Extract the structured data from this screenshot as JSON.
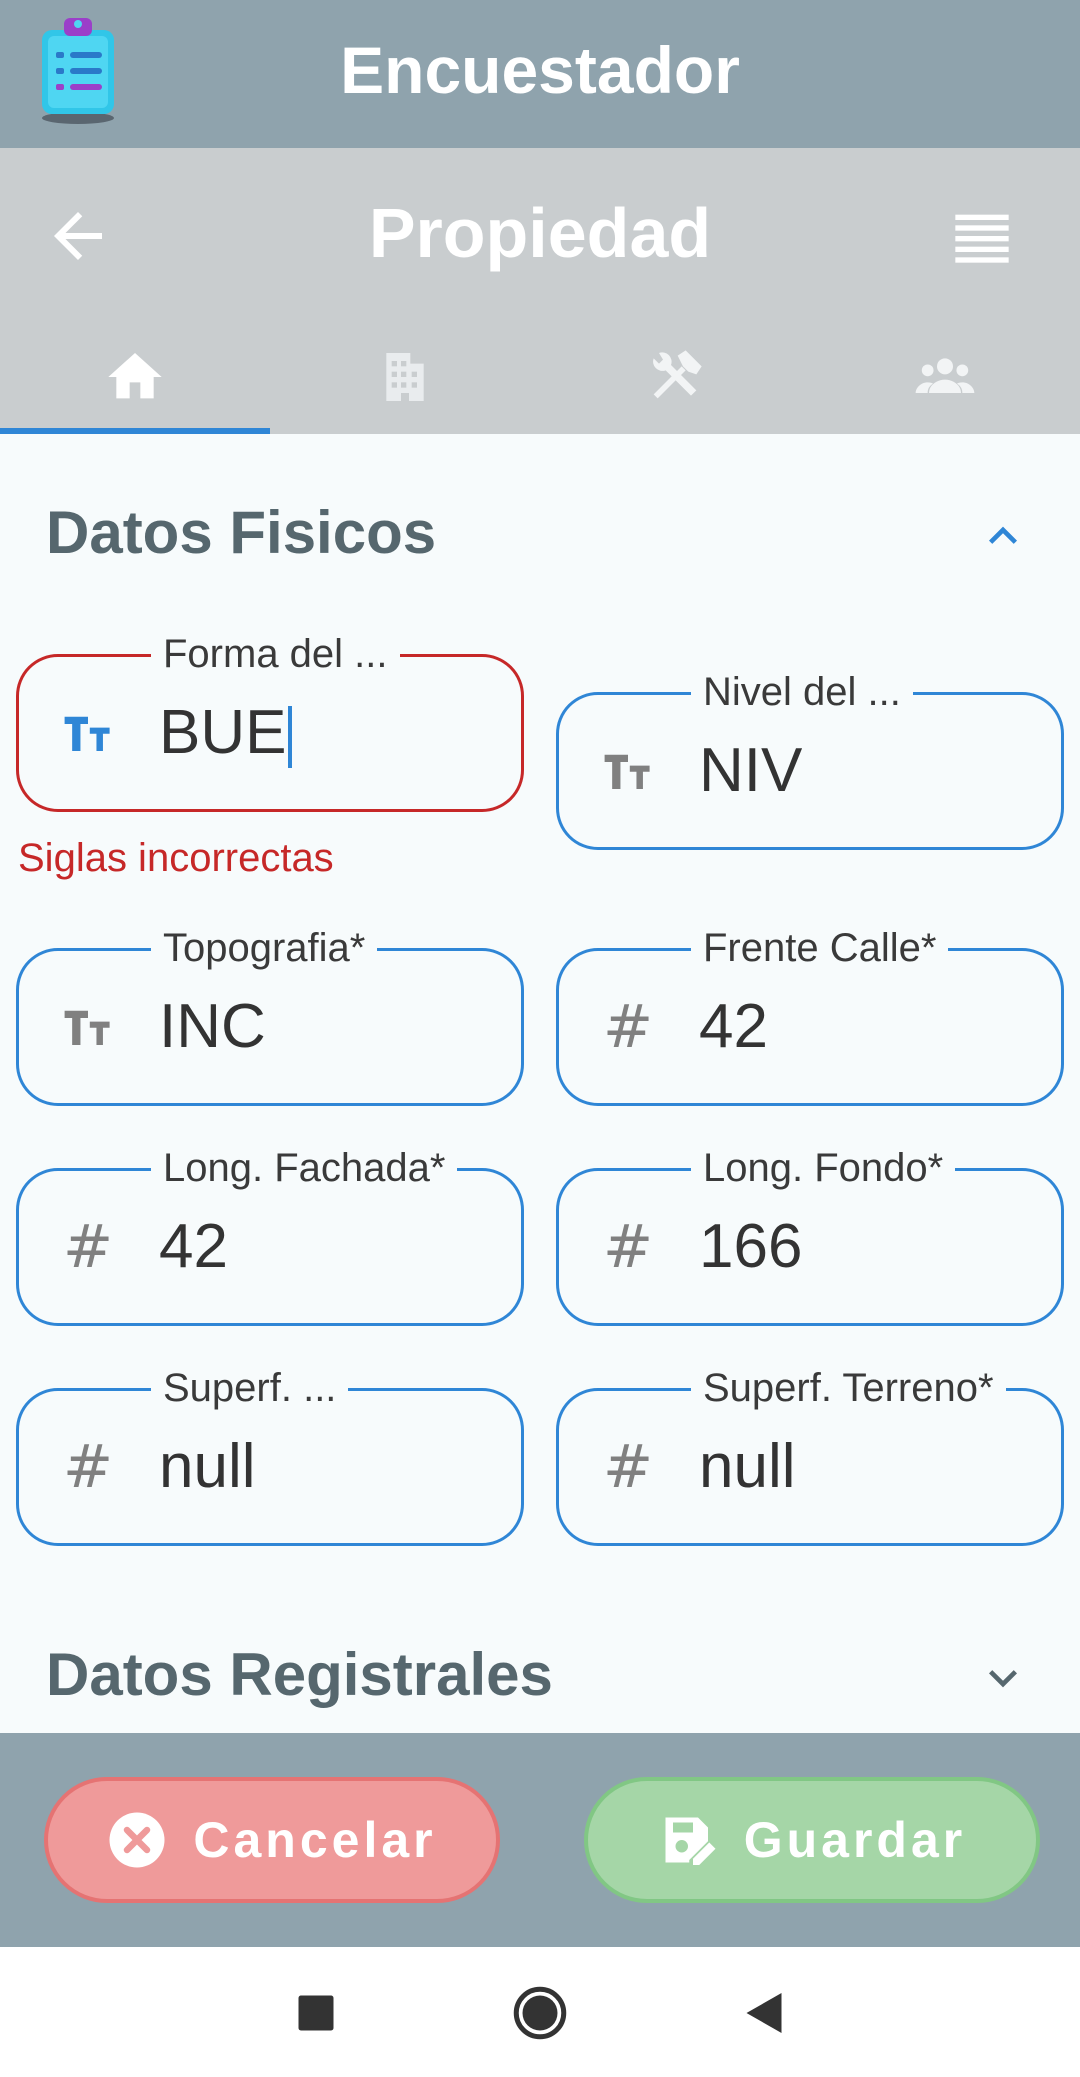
{
  "app": {
    "title": "Encuestador"
  },
  "header": {
    "title": "Propiedad"
  },
  "tabs": [
    {
      "icon": "home-icon",
      "active": true
    },
    {
      "icon": "building-icon",
      "active": false
    },
    {
      "icon": "tools-icon",
      "active": false
    },
    {
      "icon": "people-icon",
      "active": false
    }
  ],
  "sections": {
    "fisicos": {
      "title": "Datos Fisicos",
      "expanded": true
    },
    "registrales": {
      "title": "Datos Registrales",
      "expanded": false
    }
  },
  "fields": {
    "forma": {
      "label": "Forma del ...",
      "value": "BUE",
      "icon": "text-icon",
      "focused": true
    },
    "nivel": {
      "label": "Nivel del ...",
      "value": "NIV",
      "icon": "text-icon"
    },
    "topografia": {
      "label": "Topografia*",
      "value": "INC",
      "icon": "text-icon"
    },
    "frente_calle": {
      "label": "Frente Calle*",
      "value": "42",
      "icon": "number-icon"
    },
    "long_fachada": {
      "label": "Long. Fachada*",
      "value": "42",
      "icon": "number-icon"
    },
    "long_fondo": {
      "label": "Long. Fondo*",
      "value": "166",
      "icon": "number-icon"
    },
    "superf_cubierta": {
      "label": "Superf. ...",
      "value": "null",
      "icon": "number-icon"
    },
    "superf_terreno": {
      "label": "Superf. Terreno*",
      "value": "null",
      "icon": "number-icon"
    }
  },
  "error": {
    "message": "Siglas incorrectas"
  },
  "actions": {
    "cancel_label": "Cancelar",
    "save_label": "Guardar"
  },
  "colors": {
    "appbar": "#8fa3ad",
    "subbar": "#c9cdcf",
    "accent": "#2f86d6",
    "error": "#c62828",
    "cancel": "#ef9a9a",
    "save": "#a5d6a7"
  }
}
